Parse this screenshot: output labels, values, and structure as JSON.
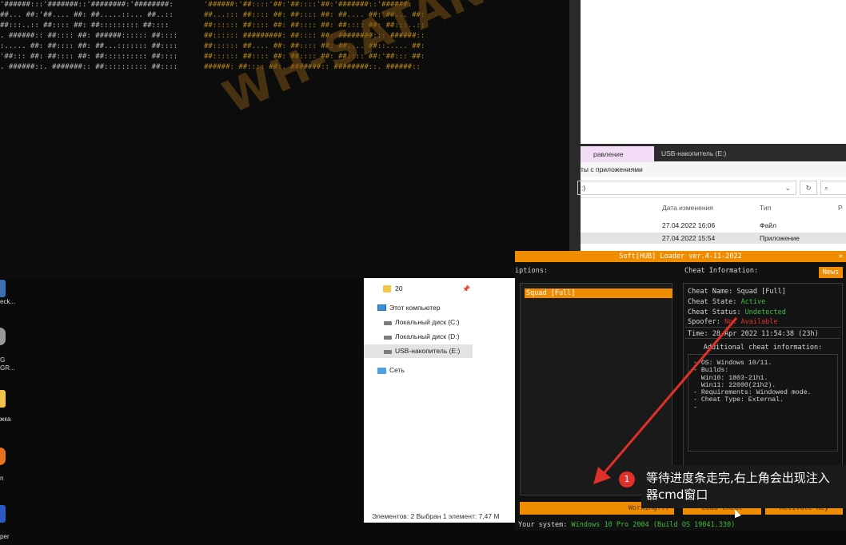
{
  "console": {
    "art_left": "'######:::'#######::'########:'########:\n##... ##:'##.... ##: ##.....::... ##..::\n##:::..:: ##:::: ##: ##::::::::: ##::::\n. ######:: ##:::: ##: ######:::::: ##::::\n:..... ##: ##:::: ##: ##...::::::: ##::::\n'##::: ##: ##:::: ##: ##:::::::::: ##::::\n. ######::. #######:: ##:::::::::: ##::::",
    "art_right": "'######:'##::::'##:'##::::'##:'#######::'######:\n##...::: ##:::: ##: ##:::: ##: ##.... ##:'##... ##:\n##:::::: ##:::: ##: ##:::: ##: ##:::: ##: ##:::..::\n##:::::: #########: ##:::: ##: ########::: ######::\n##:::::: ##.... ##: ##:::: ##: ##.... ##::..... ##:\n##:::::: ##:::: ##: ##:::: ##: ##:::: ##:'##::: ##:\n######: ##:::: ##:. #######:: ########::. ######::"
  },
  "watermark": "WH-SATANO.RU/EN",
  "explorer_top": {
    "tab_manage": "равление",
    "tab_usb": "USB-накопитель (E:)",
    "subtab": "ты с приложениями",
    "address": ":)",
    "refresh_icon": "↻",
    "search_glyph": "⌕",
    "headers": [
      "Дата изменения",
      "Тип",
      "Р"
    ],
    "rows": [
      {
        "date": "27.04.2022 16:06",
        "type": "Файл"
      },
      {
        "date": "27.04.2022 15:54",
        "type": "Приложение"
      }
    ]
  },
  "explorer_nav": {
    "items": [
      {
        "label": "20",
        "icon": "folder-icon"
      },
      {
        "label": "Этот компьютер",
        "icon": "computer-icon"
      },
      {
        "label": "Локальный диск (C:)",
        "icon": "disk-icon"
      },
      {
        "label": "Локальный диск (D:)",
        "icon": "disk-icon"
      },
      {
        "label": "USB-накопитель (E:)",
        "icon": "disk-icon"
      },
      {
        "label": "Сеть",
        "icon": "network-icon"
      }
    ],
    "pin": "📌",
    "status": "Элементов: 2     Выбран 1 элемент: 7,47 М"
  },
  "loader": {
    "title": "Soft[HUB] Loader ver.4-11-2022",
    "close": "✕",
    "desc_label": "iptions:",
    "list_item": "Squad [Full]",
    "info_label": "Cheat Information:",
    "news": "News",
    "name_label": "Cheat Name: ",
    "name_value": "Squad [Full]",
    "state_label": "Cheat State: ",
    "state_value": "Active",
    "status_label": "Cheat Status: ",
    "status_value": "Undetected",
    "spoofer_label": "Spoofer: ",
    "spoofer_value": "Not Available",
    "time": "Time: 28 Apr 2022 11:54:38 (23h)",
    "addl_title": "Additional cheat information:",
    "addl_text": "- OS: Windows 10/11.\n- Builds:\n  Win10: 1803-21h1.\n  Win11: 22000(21h2).\n- Requirements: Windowed mode.\n- Cheat Type: External.\n-",
    "progress_label": "Working...",
    "load_label": "Load Cheat",
    "activate_label": "Activate Key",
    "system_label": "Your system: ",
    "system_value": "Windows 10 Pro 2004 (Build OS 19041.330)"
  },
  "desktop": {
    "labels": [
      "eck...",
      "G\nGR...",
      "жка",
      "n",
      "per"
    ]
  },
  "annotation": {
    "badge": "1",
    "text": "等待进度条走完,右上角会出现注入器cmd窗口"
  },
  "colors": {
    "accent": "#f08c00",
    "active": "#3fbf3f",
    "warning": "#e0302a",
    "arrow": "#e0302a"
  }
}
